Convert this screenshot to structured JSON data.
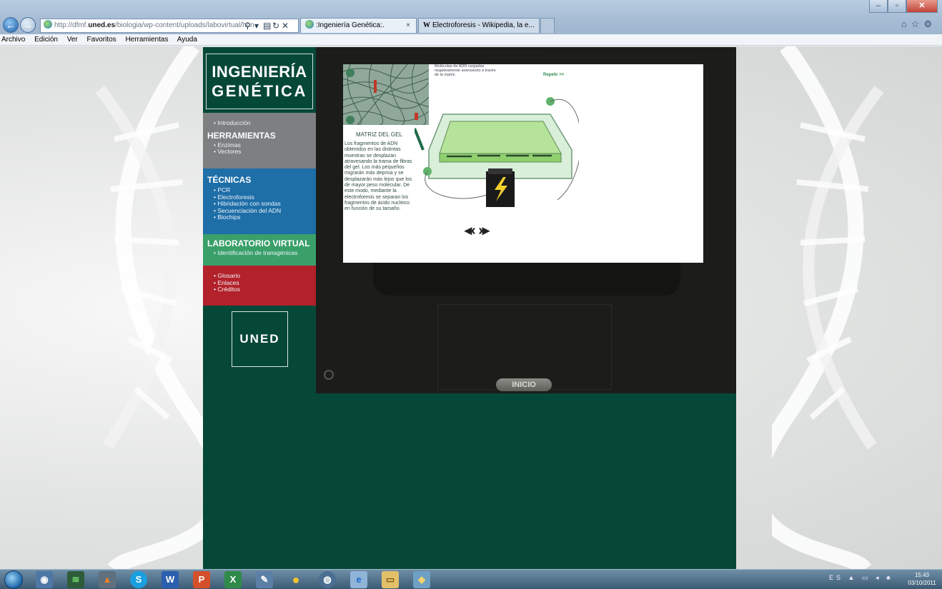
{
  "browser": {
    "address_prefix": "http://dfmf.",
    "address_domain": "uned.es",
    "address_rest": "/biologia/wp-content/uploads/labovirtual/hon",
    "tabs": [
      {
        "label": ":Ingeniería Genética:.",
        "close": "×"
      },
      {
        "label": "Electroforesis - Wikipedia, la e..."
      }
    ],
    "wiki_glyph": "W",
    "menu": [
      "Archivo",
      "Edición",
      "Ver",
      "Favoritos",
      "Herramientas",
      "Ayuda"
    ]
  },
  "site": {
    "title_line1": "INGENIERÍA",
    "title_line2": "GENÉTICA",
    "intro": "Introducción",
    "herramientas": {
      "label": "HERRAMIENTAS",
      "items": [
        "Enzimas",
        "Vectores"
      ]
    },
    "tecnicas": {
      "label": "TÉCNICAS",
      "items": [
        "PCR",
        "Electroforesis",
        "Hibridación con sondas",
        "Secuenciación del ADN",
        "Biochips"
      ]
    },
    "laboratorio": {
      "label": "LABORATORIO VIRTUAL",
      "items": [
        "Identificación de transgénicas"
      ]
    },
    "extras": [
      "Glosario",
      "Enlaces",
      "Créditos"
    ],
    "logo_text": "UNED",
    "home_button": "INICIO"
  },
  "slide": {
    "top_note": "Moléculas de ADN cargadas negativamente avanzando a través de la matriz.",
    "repeat_link": "Repetir >>",
    "matrix_title": "MATRIZ DEL GEL",
    "body": "Los fragmentos de ADN obtenidos en las distintas muestras se desplazan atravesando la trama de fibras del gel. Los más pequeños migrarán más deprisa y se desplazarán más lejos que los de mayor peso molecular. De este modo, mediante la electroforesis se separan los fragmentos de ácido nucleico en función de su tamaño.",
    "arrows": "◂‹ ›▸"
  },
  "taskbar": {
    "lang": "ES",
    "time": "15:43",
    "date": "03/10/2011"
  },
  "colors": {
    "site_bg": "#064838",
    "gray": "#7d7f81",
    "blue": "#1e6ea8",
    "green": "#3aa06a",
    "red": "#b3212a"
  }
}
